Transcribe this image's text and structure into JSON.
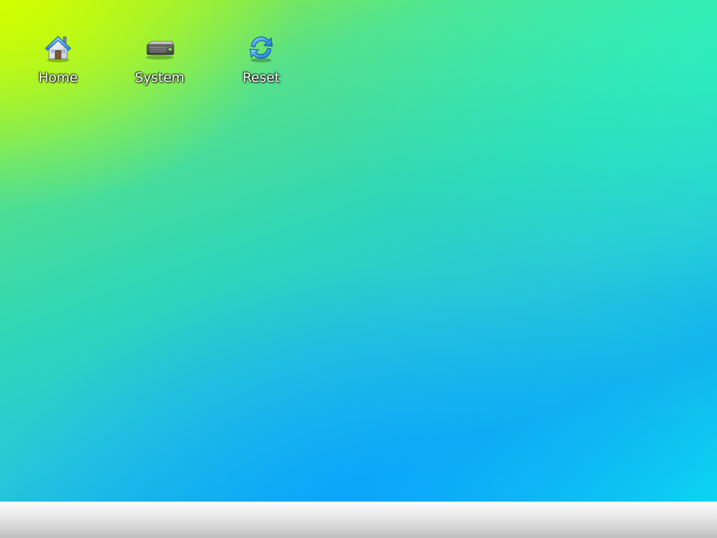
{
  "desktop": {
    "icons": [
      {
        "label": "Home",
        "icon": "home-icon"
      },
      {
        "label": "System",
        "icon": "system-drive-icon"
      },
      {
        "label": "Reset",
        "icon": "reset-icon"
      }
    ]
  },
  "colors": {
    "background_top_left": "#d4ff00",
    "background_mid": "#30d8b4",
    "background_bottom": "#0aa8f8",
    "taskbar": "#e0e0e0"
  }
}
